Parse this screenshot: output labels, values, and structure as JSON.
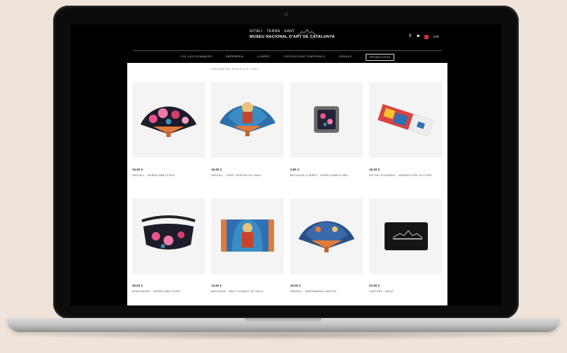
{
  "site": {
    "logo_line1": "GITALI · TERRA · SANT",
    "logo_line2": "MUSEU NACIONAL D'ART DE CATALUNYA",
    "language": "CAT",
    "nav": [
      "COL·LECCIONABLES",
      "PAPERERIA",
      "LLIBRES",
      "EXPOSICIONS TEMPORALS",
      "REGALS",
      "PROMOCIONS"
    ],
    "breadcrumb": "PINTURA DEL SEGLE XVII I XVIII"
  },
  "products": [
    {
      "price": "19,90 €",
      "name": "VENTALL · GERRO AMB FLORS",
      "image": "fan-floral"
    },
    {
      "price": "19,90 €",
      "name": "VENTALL · CRIST SENYOR DE TAÜLL",
      "image": "fan-pantocrator"
    },
    {
      "price": "3,95 €",
      "name": "MOCADOR LLIBRES · GERRO AMB FLORS",
      "image": "pin-box"
    },
    {
      "price": "15,00 €",
      "name": "ESTOIG PLEGABLE · HARPIES PER LECTORS",
      "image": "folder"
    },
    {
      "price": "29,00 €",
      "name": "RONYONERA · GERRO AMB FLORS",
      "image": "waist-bag"
    },
    {
      "price": "14,90 €",
      "name": "MOCADOR · SANT CLIMENT DE TAÜLL",
      "image": "pantocrator-scarf"
    },
    {
      "price": "19,90 €",
      "name": "VENTALL · MAPPAMUNDI SANTES",
      "image": "fan-blue"
    },
    {
      "price": "22,90 €",
      "name": "CARTERA · MNAC",
      "image": "wallet"
    }
  ],
  "colors": {
    "wood": "#e07a3a",
    "site_bg": "#ffffff",
    "header_bg": "#000000",
    "desk": "#efe3da"
  }
}
